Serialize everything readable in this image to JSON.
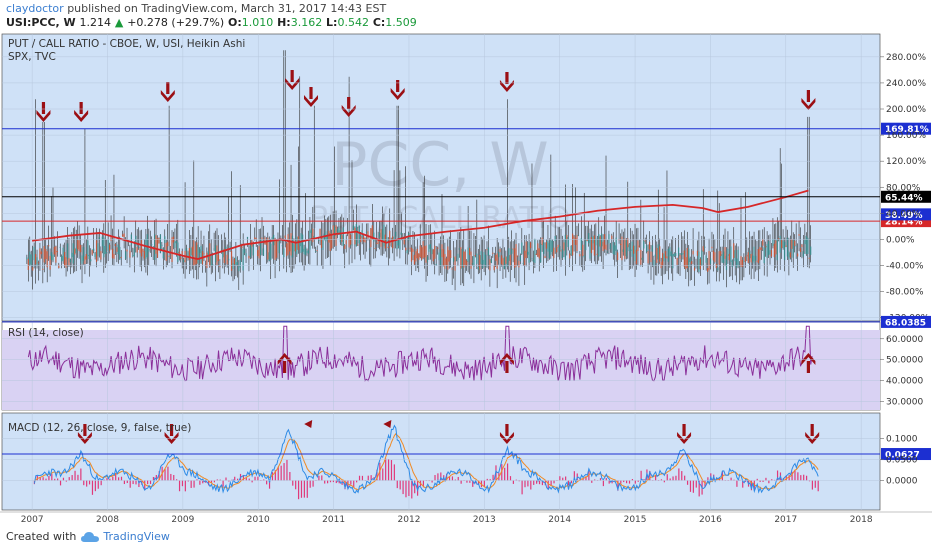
{
  "header": {
    "author": "claydoctor",
    "published": "published on TradingView.com, March 31, 2017 14:43 EST",
    "symbol": "USI:PCC, W",
    "last": "1.214",
    "change": "+0.278 (+29.7%)",
    "o_label": "O:",
    "o_value": "1.010",
    "h_label": "H:",
    "h_value": "3.162",
    "l_label": "L:",
    "l_value": "0.542",
    "c_label": "C:",
    "c_value": "1.509"
  },
  "footer": {
    "created": "Created with",
    "brand": "TradingView"
  },
  "colors": {
    "panel_bg": "#cfe1f7",
    "rsi_bg": "#d9d2f3",
    "candle": "#2b2b2b",
    "spx": "#d62728",
    "rsi_line": "#8a2f9a",
    "macd_line": "#2e8be6",
    "signal_line": "#f08a24",
    "hist": "#e0397a",
    "arrow": "#9b0f14",
    "blue_level": "#1c2fd1",
    "red_level": "#d62728",
    "black_level": "#000000"
  },
  "chart_data": [
    {
      "type": "candlestick",
      "title": "PUT / CALL RATIO - CBOE, W, USI, Heikin Ashi",
      "overlay": "SPX, TVC",
      "watermark": "PCC, W",
      "watermark_sub": "PUT / CALL RATIO",
      "x_ticks": [
        "2007",
        "2008",
        "2009",
        "2010",
        "2011",
        "2012",
        "2013",
        "2014",
        "2015",
        "2016",
        "2017",
        "2018"
      ],
      "x_range": [
        2006.6,
        2018.25
      ],
      "y_unit": "%",
      "y_ticks": [
        "280.00%",
        "240.00%",
        "200.00%",
        "160.00%",
        "120.00%",
        "80.00%",
        "40.00%",
        "0.00%",
        "-40.00%",
        "-80.00%",
        "-120.00%"
      ],
      "y_tick_values": [
        280,
        240,
        200,
        160,
        120,
        80,
        40,
        0,
        -40,
        -80,
        -120
      ],
      "y_range": [
        -125,
        315
      ],
      "levels": [
        {
          "value": 169.81,
          "label": "169.81%",
          "color": "#1c2fd1"
        },
        {
          "value": 65.44,
          "label": "65.44%",
          "color": "#000000"
        },
        {
          "value": 28.14,
          "label": "28.14%",
          "color": "#d62728"
        }
      ],
      "last_labels": [
        {
          "value": 38.49,
          "label": "38.49%",
          "color": "#1c2fd1"
        }
      ],
      "spikes": [
        {
          "x": 2007.05,
          "y": 215
        },
        {
          "x": 2007.15,
          "y": 180
        },
        {
          "x": 2007.7,
          "y": 170
        },
        {
          "x": 2008.82,
          "y": 205
        },
        {
          "x": 2010.35,
          "y": 290
        },
        {
          "x": 2010.55,
          "y": 250
        },
        {
          "x": 2010.75,
          "y": 205
        },
        {
          "x": 2011.2,
          "y": 180
        },
        {
          "x": 2011.85,
          "y": 205
        },
        {
          "x": 2013.3,
          "y": 215
        },
        {
          "x": 2016.1,
          "y": 75
        },
        {
          "x": 2017.3,
          "y": 188
        }
      ],
      "spx_series": {
        "x": [
          2007.0,
          2007.5,
          2007.9,
          2008.5,
          2009.0,
          2009.2,
          2009.8,
          2010.3,
          2010.5,
          2011.0,
          2011.3,
          2011.7,
          2012.0,
          2012.5,
          2013.0,
          2013.5,
          2014.0,
          2014.5,
          2015.0,
          2015.5,
          2015.9,
          2016.1,
          2016.5,
          2017.0,
          2017.3
        ],
        "y": [
          -2,
          6,
          10,
          -10,
          -25,
          -30,
          -8,
          0,
          -5,
          8,
          12,
          -5,
          5,
          12,
          18,
          28,
          35,
          44,
          50,
          53,
          48,
          42,
          50,
          65,
          75
        ]
      },
      "arrows_down": [
        2007.15,
        2007.65,
        2008.8,
        2010.45,
        2010.7,
        2011.2,
        2011.85,
        2013.3,
        2017.3
      ]
    },
    {
      "type": "line",
      "title": "RSI (14, close)",
      "y_ticks": [
        "60.0000",
        "50.0000",
        "40.0000",
        "30.0000"
      ],
      "y_tick_values": [
        60,
        50,
        40,
        30
      ],
      "y_range": [
        26,
        68
      ],
      "levels": [
        {
          "value": 68.0385,
          "label": "68.0385",
          "color": "#1c2fd1"
        }
      ],
      "arrows_up": [
        2010.35,
        2013.3,
        2017.3
      ]
    },
    {
      "type": "line",
      "title": "MACD (12, 26, close, 9, false, true)",
      "y_ticks": [
        "0.1000",
        "0.0500",
        "0.0000"
      ],
      "y_tick_values": [
        0.1,
        0.05,
        0.0
      ],
      "y_range": [
        -0.07,
        0.16
      ],
      "levels": [
        {
          "value": 0.0627,
          "label": "0.0627",
          "color": "#1c2fd1"
        }
      ],
      "macd_peaks": [
        {
          "x": 2007.65,
          "y": 0.085
        },
        {
          "x": 2008.8,
          "y": 0.065
        },
        {
          "x": 2010.4,
          "y": 0.15
        },
        {
          "x": 2011.8,
          "y": 0.11
        },
        {
          "x": 2013.3,
          "y": 0.075
        },
        {
          "x": 2015.65,
          "y": 0.085
        },
        {
          "x": 2017.3,
          "y": 0.045
        }
      ],
      "arrows_down": [
        2007.7,
        2008.85,
        2013.3,
        2015.65,
        2017.35
      ],
      "arrows_small": [
        2010.65,
        2011.7
      ]
    }
  ]
}
